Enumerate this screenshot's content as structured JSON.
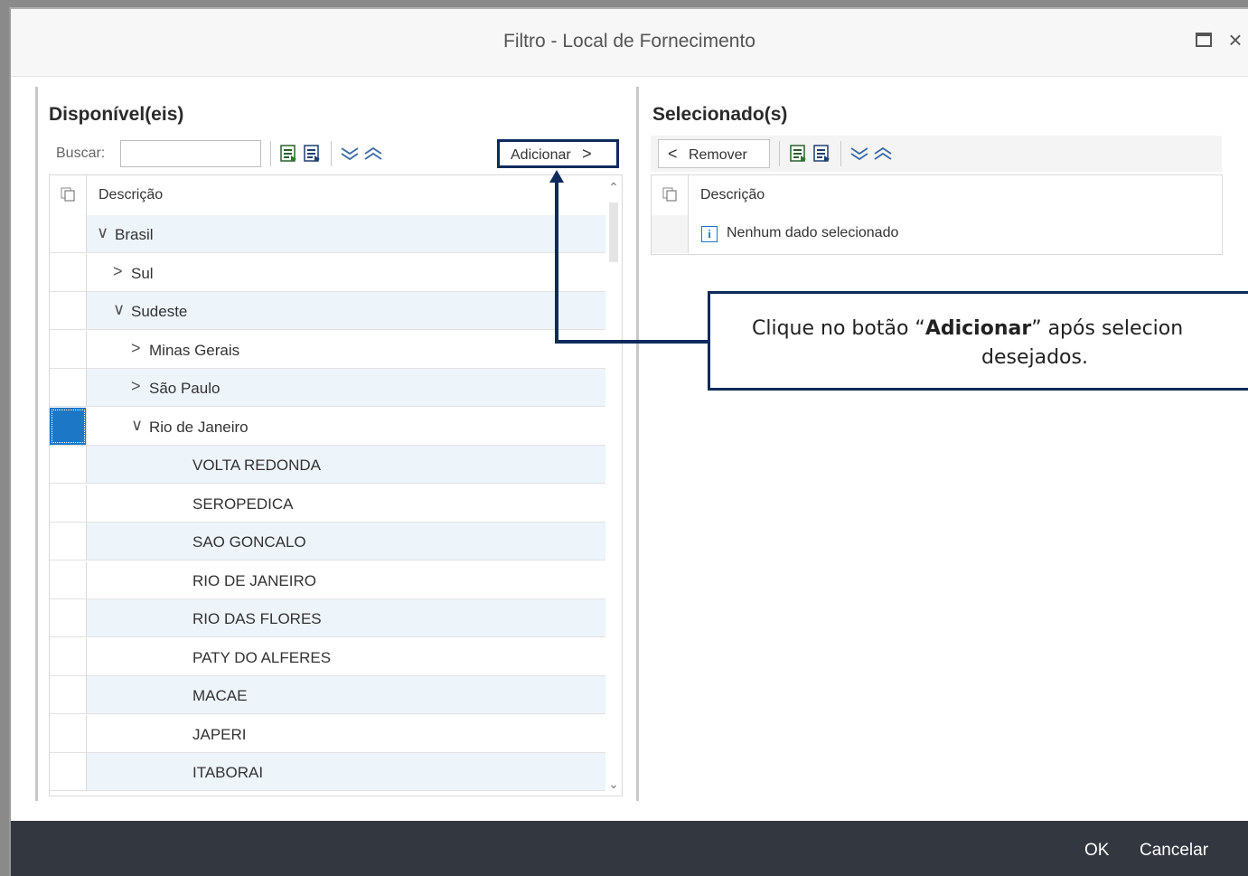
{
  "dialog": {
    "title": "Filtro - Local de Fornecimento",
    "maximize_icon": "maximize-icon",
    "close_icon": "close-icon",
    "close_glyph": "×"
  },
  "available": {
    "title": "Disponível(eis)",
    "search_label": "Buscar:",
    "search_value": "",
    "add_button_label": "Adicionar",
    "add_button_glyph": ">",
    "column_header": "Descrição",
    "rows": [
      {
        "label": "Brasil",
        "expander": "∨",
        "level": 0
      },
      {
        "label": "Sul",
        "expander": ">",
        "level": 1
      },
      {
        "label": "Sudeste",
        "expander": "∨",
        "level": 1
      },
      {
        "label": "Minas Gerais",
        "expander": ">",
        "level": 2
      },
      {
        "label": "São Paulo",
        "expander": ">",
        "level": 2
      },
      {
        "label": "Rio de Janeiro",
        "expander": "∨",
        "level": 2
      },
      {
        "label": "VOLTA REDONDA",
        "expander": "",
        "level": 3
      },
      {
        "label": "SEROPEDICA",
        "expander": "",
        "level": 3
      },
      {
        "label": "SAO GONCALO",
        "expander": "",
        "level": 3
      },
      {
        "label": "RIO DE JANEIRO",
        "expander": "",
        "level": 3
      },
      {
        "label": "RIO DAS FLORES",
        "expander": "",
        "level": 3
      },
      {
        "label": "PATY DO ALFERES",
        "expander": "",
        "level": 3
      },
      {
        "label": "MACAE",
        "expander": "",
        "level": 3
      },
      {
        "label": "JAPERI",
        "expander": "",
        "level": 3
      },
      {
        "label": "ITABORAI",
        "expander": "",
        "level": 3
      }
    ]
  },
  "selected": {
    "title": "Selecionado(s)",
    "remove_button_label": "Remover",
    "remove_button_glyph": "<",
    "column_header": "Descrição",
    "empty_message": "Nenhum dado selecionado",
    "info_glyph": "i"
  },
  "callout": {
    "line1_prefix": "Clique no botão “",
    "line1_bold": "Adicionar",
    "line1_suffix": "” após selecion",
    "line2": "desejados."
  },
  "footer": {
    "ok_label": "OK",
    "cancel_label": "Cancelar"
  },
  "colors": {
    "accent": "#1c78c6",
    "callout_border": "#0f2a5c",
    "footer_bg": "#333740",
    "row_alt": "#edf4fa"
  }
}
